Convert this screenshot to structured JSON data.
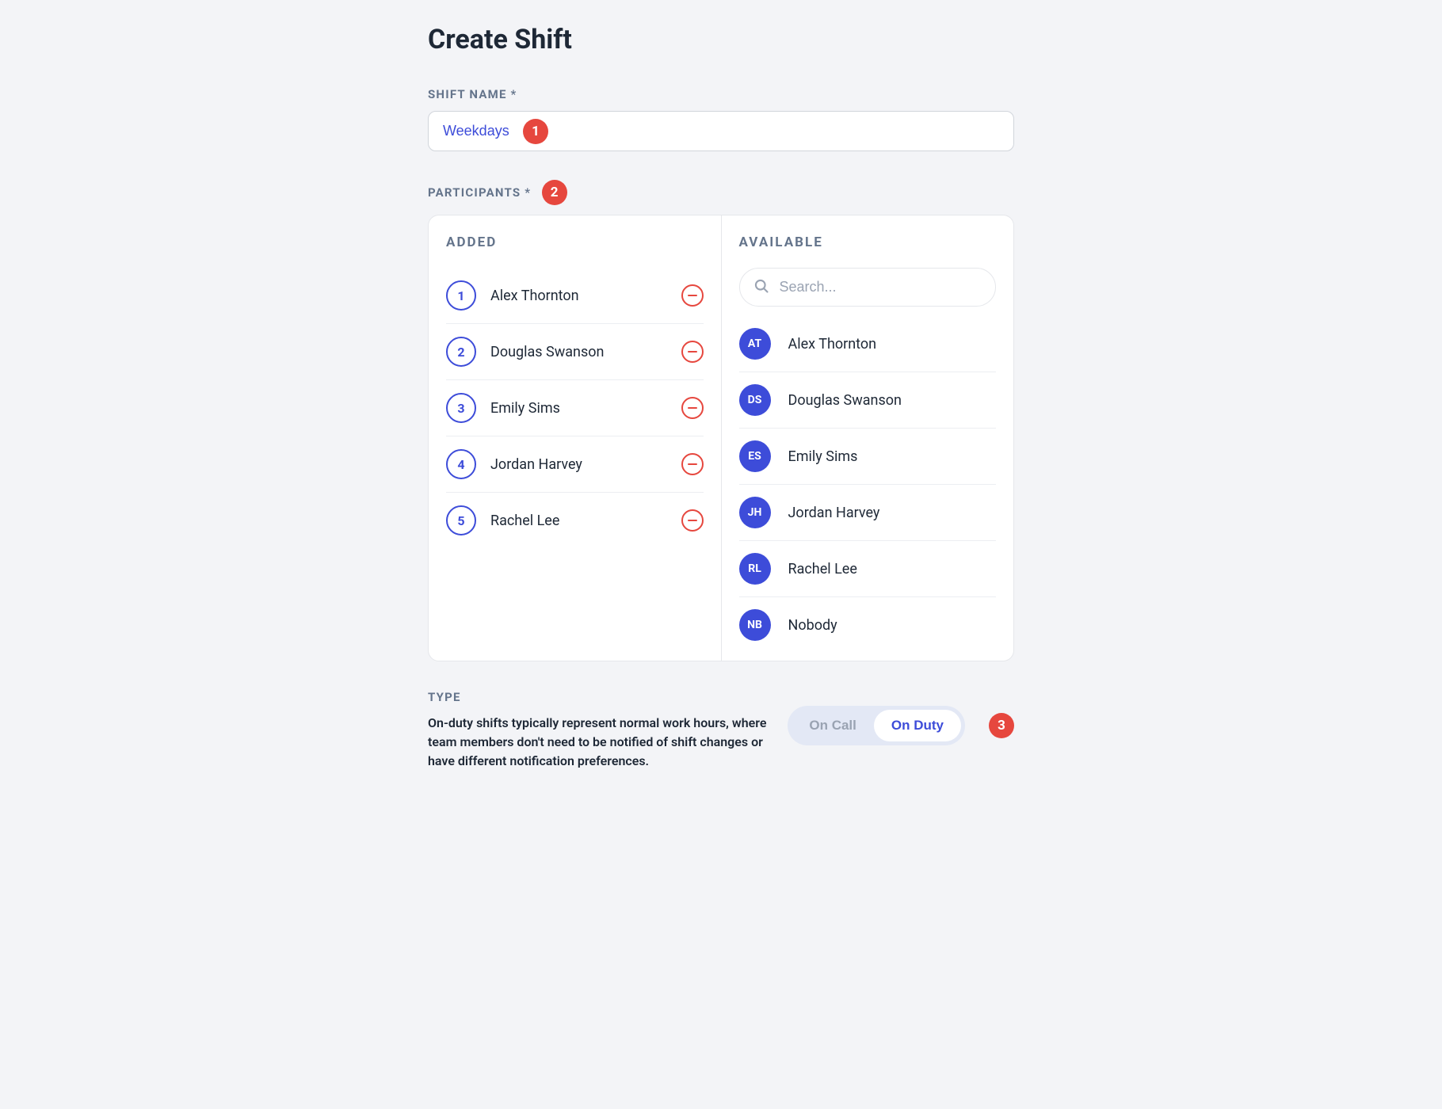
{
  "title": "Create Shift",
  "callouts": {
    "shift_name": "1",
    "participants": "2",
    "type": "3"
  },
  "shift_name": {
    "label": "SHIFT NAME *",
    "value": "Weekdays"
  },
  "participants": {
    "label": "PARTICIPANTS *",
    "added_label": "ADDED",
    "available_label": "AVAILABLE",
    "search_placeholder": "Search...",
    "added": [
      {
        "order": "1",
        "name": "Alex Thornton"
      },
      {
        "order": "2",
        "name": "Douglas Swanson"
      },
      {
        "order": "3",
        "name": "Emily Sims"
      },
      {
        "order": "4",
        "name": "Jordan Harvey"
      },
      {
        "order": "5",
        "name": "Rachel Lee"
      }
    ],
    "available": [
      {
        "initials": "AT",
        "name": "Alex Thornton"
      },
      {
        "initials": "DS",
        "name": "Douglas Swanson"
      },
      {
        "initials": "ES",
        "name": "Emily Sims"
      },
      {
        "initials": "JH",
        "name": "Jordan Harvey"
      },
      {
        "initials": "RL",
        "name": "Rachel Lee"
      },
      {
        "initials": "NB",
        "name": "Nobody"
      }
    ]
  },
  "type": {
    "label": "TYPE",
    "description": "On-duty shifts typically represent normal work hours, where team members don't need to be notified of shift changes or have different notification preferences.",
    "options": {
      "on_call": "On Call",
      "on_duty": "On Duty"
    },
    "selected": "on_duty"
  }
}
